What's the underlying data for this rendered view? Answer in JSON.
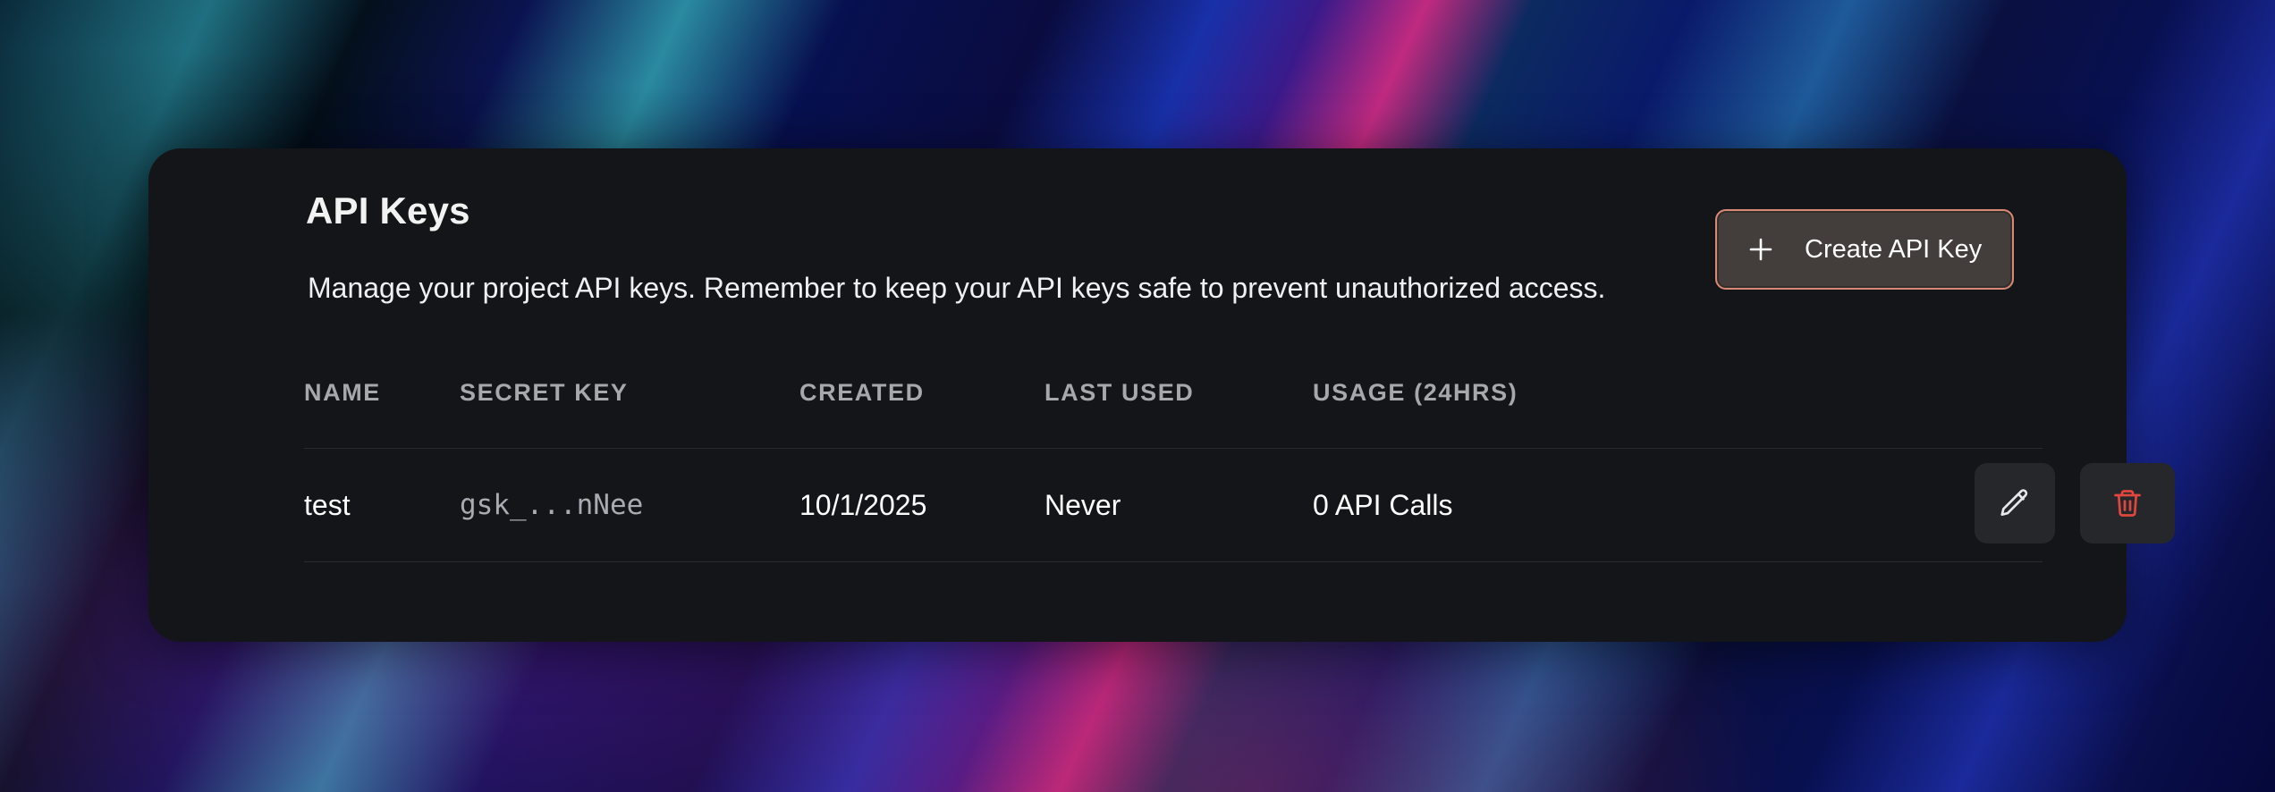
{
  "page": {
    "title": "API Keys",
    "description": "Manage your project API keys. Remember to keep your API keys safe to prevent unauthorized access.",
    "create_button_label": "Create API Key"
  },
  "table": {
    "columns": [
      "NAME",
      "SECRET KEY",
      "CREATED",
      "LAST USED",
      "USAGE (24HRS)"
    ],
    "rows": [
      {
        "name": "test",
        "secret_key": "gsk_...nNee",
        "created": "10/1/2025",
        "last_used": "Never",
        "usage": "0 API Calls"
      }
    ]
  },
  "icons": {
    "create": "plus-icon",
    "edit": "pencil-icon",
    "delete": "trash-icon"
  },
  "colors": {
    "card_background": "#141518",
    "accent_border": "#d98a74",
    "delete_icon": "#e0483e"
  }
}
